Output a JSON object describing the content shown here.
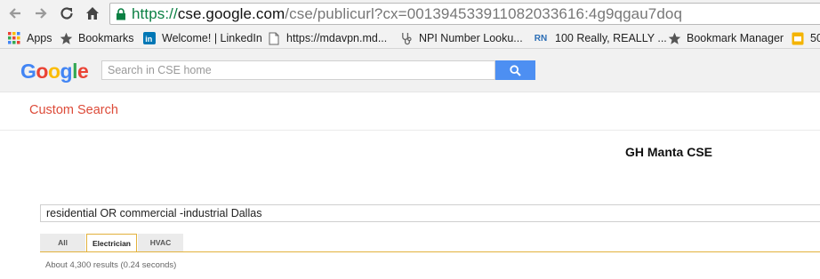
{
  "browser": {
    "url": {
      "scheme": "https://",
      "host": "cse.google.com",
      "path": "/cse/publicurl?cx=001394533911082033616:4g9qgau7doq"
    },
    "bookmarks": [
      {
        "label": "Apps",
        "icon": "apps-grid-icon"
      },
      {
        "label": "Bookmarks",
        "icon": "star-icon"
      },
      {
        "label": "Welcome! | LinkedIn",
        "icon": "linkedin-icon"
      },
      {
        "label": "https://mdavpn.md...",
        "icon": "page-icon"
      },
      {
        "label": "NPI Number Looku...",
        "icon": "stethoscope-icon"
      },
      {
        "label": "100 Really, REALLY ...",
        "icon": "rn-icon",
        "icon_text": "RN"
      },
      {
        "label": "Bookmark Manager",
        "icon": "star-icon"
      },
      {
        "label": "50",
        "icon": "slides-icon"
      }
    ]
  },
  "header": {
    "logo_letters": [
      {
        "ch": "G",
        "color": "#4285f4"
      },
      {
        "ch": "o",
        "color": "#ea4335"
      },
      {
        "ch": "o",
        "color": "#fbbc05"
      },
      {
        "ch": "g",
        "color": "#4285f4"
      },
      {
        "ch": "l",
        "color": "#34a853"
      },
      {
        "ch": "e",
        "color": "#ea4335"
      }
    ],
    "search_placeholder": "Search in CSE home"
  },
  "page": {
    "custom_search_title": "Custom Search",
    "engine_name": "GH Manta CSE",
    "query": "residential OR commercial -industrial Dallas",
    "tabs": [
      {
        "label": "All",
        "active": false
      },
      {
        "label": "Electrician",
        "active": true
      },
      {
        "label": "HVAC",
        "active": false
      }
    ],
    "result_stats": "About 4,300 results (0.24 seconds)"
  },
  "colors": {
    "accent_red": "#dd4b39",
    "tab_accent": "#e2b13c",
    "search_button": "#4d8ff2",
    "secure_green": "#0b8043"
  }
}
